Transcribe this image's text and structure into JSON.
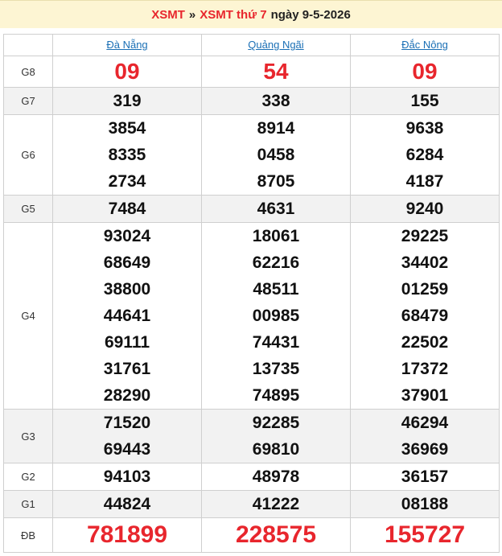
{
  "header": {
    "region_link": "XSMT",
    "separator": "»",
    "day_link": "XSMT thứ 7",
    "date_text": "ngày 9-5-2026"
  },
  "provinces": [
    "Đà Nẵng",
    "Quảng Ngãi",
    "Đắc Nông"
  ],
  "prizes": [
    {
      "label": "G8",
      "values": [
        [
          "09"
        ],
        [
          "54"
        ],
        [
          "09"
        ]
      ]
    },
    {
      "label": "G7",
      "values": [
        [
          "319"
        ],
        [
          "338"
        ],
        [
          "155"
        ]
      ]
    },
    {
      "label": "G6",
      "values": [
        [
          "3854",
          "8335",
          "2734"
        ],
        [
          "8914",
          "0458",
          "8705"
        ],
        [
          "9638",
          "6284",
          "4187"
        ]
      ]
    },
    {
      "label": "G5",
      "values": [
        [
          "7484"
        ],
        [
          "4631"
        ],
        [
          "9240"
        ]
      ]
    },
    {
      "label": "G4",
      "values": [
        [
          "93024",
          "68649",
          "38800",
          "44641",
          "69111",
          "31761",
          "28290"
        ],
        [
          "18061",
          "62216",
          "48511",
          "00985",
          "74431",
          "13735",
          "74895"
        ],
        [
          "29225",
          "34402",
          "01259",
          "68479",
          "22502",
          "17372",
          "37901"
        ]
      ]
    },
    {
      "label": "G3",
      "values": [
        [
          "71520",
          "69443"
        ],
        [
          "92285",
          "69810"
        ],
        [
          "46294",
          "36969"
        ]
      ]
    },
    {
      "label": "G2",
      "values": [
        [
          "94103"
        ],
        [
          "48978"
        ],
        [
          "36157"
        ]
      ]
    },
    {
      "label": "G1",
      "values": [
        [
          "44824"
        ],
        [
          "41222"
        ],
        [
          "08188"
        ]
      ]
    },
    {
      "label": "ĐB",
      "values": [
        [
          "781899"
        ],
        [
          "228575"
        ],
        [
          "155727"
        ]
      ]
    }
  ],
  "colors": {
    "accent_red": "#e8262d",
    "link_blue": "#1a6fb5",
    "header_bg": "#fdf5d3",
    "alt_row_bg": "#f2f2f2"
  }
}
